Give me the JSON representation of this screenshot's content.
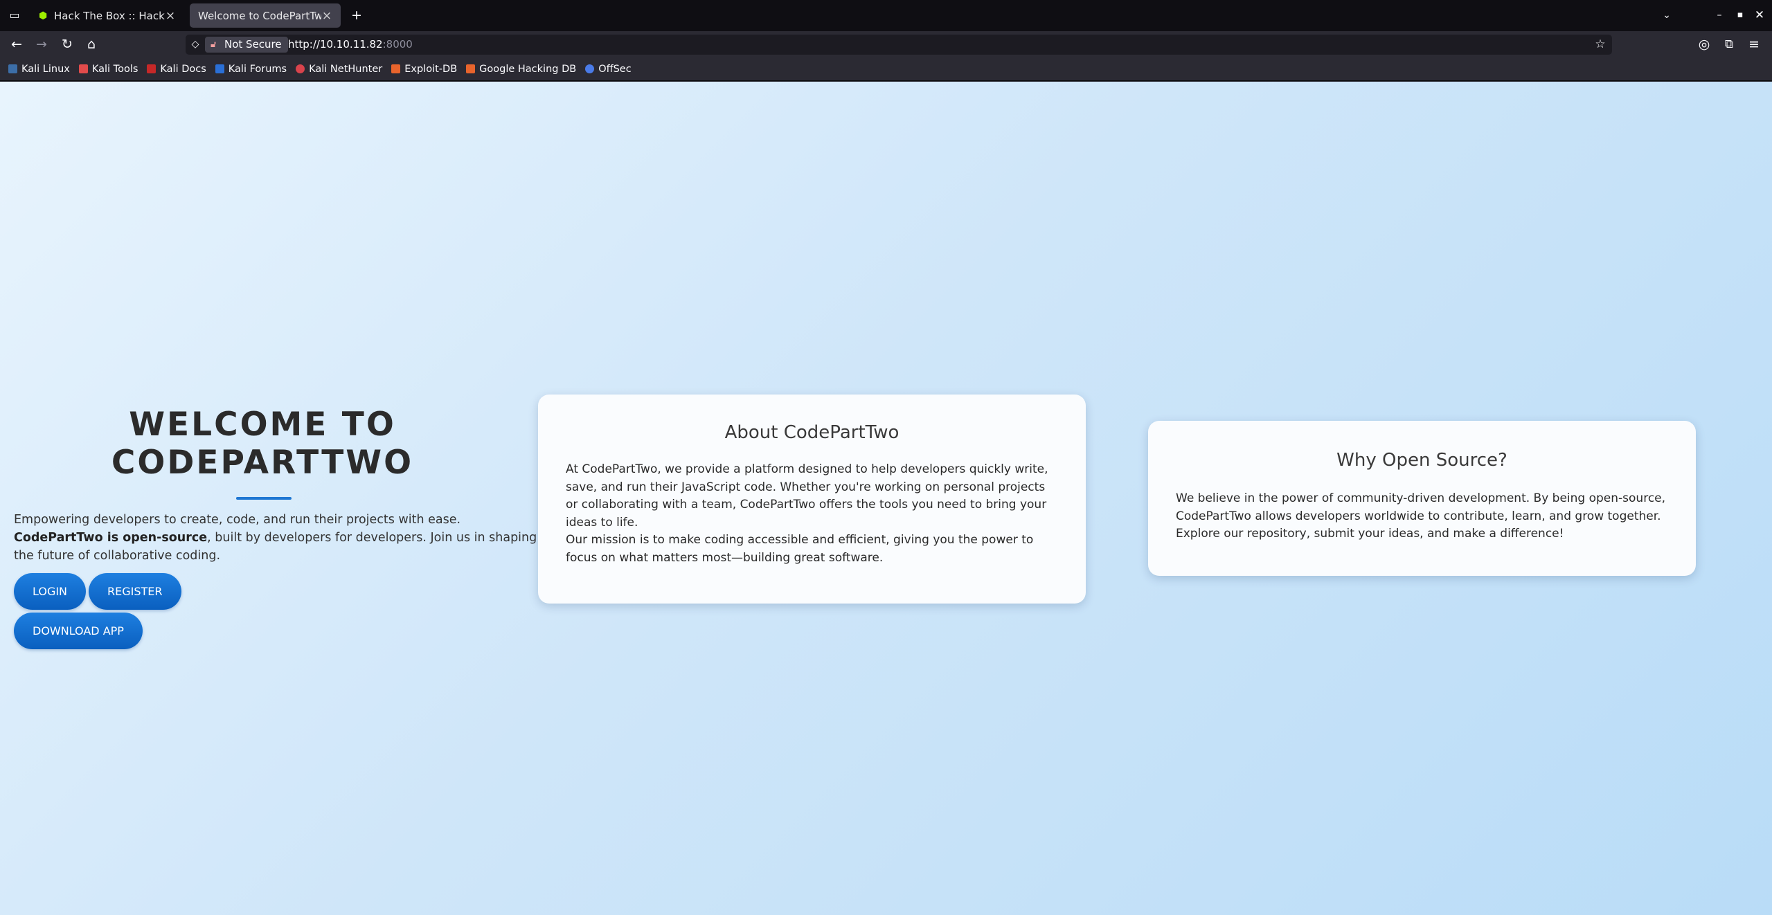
{
  "browser": {
    "tabs": [
      {
        "title": "Hack The Box :: Hack The Box",
        "active": false
      },
      {
        "title": "Welcome to CodePartTwo",
        "active": true
      }
    ],
    "security_label": "Not Secure",
    "url_host": "http://10.10.11.82",
    "url_port": ":8000",
    "bookmarks": [
      "Kali Linux",
      "Kali Tools",
      "Kali Docs",
      "Kali Forums",
      "Kali NetHunter",
      "Exploit-DB",
      "Google Hacking DB",
      "OffSec"
    ]
  },
  "hero": {
    "title": "WELCOME TO CODEPARTTWO",
    "line1": "Empowering developers to create, code, and run their projects with ease.",
    "bold": "CodePartTwo is open-source",
    "line2": ", built by developers for developers. Join us in shaping the future of collaborative coding.",
    "buttons": {
      "login": "LOGIN",
      "register": "REGISTER",
      "download": "DOWNLOAD APP"
    }
  },
  "about": {
    "title": "About CodePartTwo",
    "p1": "At CodePartTwo, we provide a platform designed to help developers quickly write, save, and run their JavaScript code. Whether you're working on personal projects or collaborating with a team, CodePartTwo offers the tools you need to bring your ideas to life.",
    "p2": "Our mission is to make coding accessible and efficient, giving you the power to focus on what matters most—building great software."
  },
  "open_source": {
    "title": "Why Open Source?",
    "p1": "We believe in the power of community-driven development. By being open-source, CodePartTwo allows developers worldwide to contribute, learn, and grow together. Explore our repository, submit your ideas, and make a difference!"
  },
  "colors": {
    "accent": "#1f77d3",
    "button": "#0a6ad0",
    "htb_green": "#9fef00"
  }
}
